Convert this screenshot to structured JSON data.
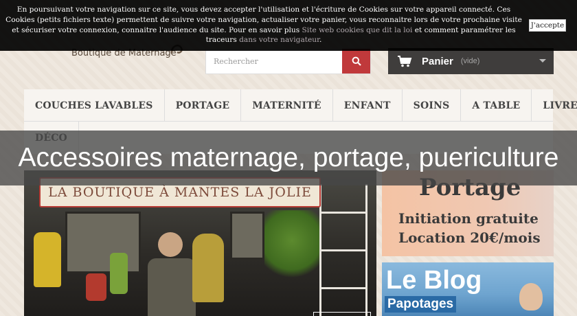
{
  "cookie_notice": {
    "text_1": "En poursuivant votre navigation sur ce site, vous devez accepter l'utilisation et l'écriture de Cookies sur votre appareil connecté. Ces Cookies (petits fichiers texte) permettent de suivre votre navigation, actualiser votre panier, vous reconnaitre lors de votre prochaine visite et sécuriser votre connexion, connaitre l'audience du site. Pour en savoir plus ",
    "link_1": "Site web cookies que dit la loi",
    "text_2": " et comment paramétrer les traceurs ",
    "link_2": "dans votre navigateur",
    "text_3": ".",
    "accept_label": "J'accepte"
  },
  "header": {
    "logo_text": "Boutique de Maternage",
    "search_placeholder": "Rechercher",
    "cart_label": "Panier",
    "cart_status": "(vide)"
  },
  "nav": {
    "row1": [
      "COUCHES LAVABLES",
      "PORTAGE",
      "MATERNITÉ",
      "ENFANT",
      "SOINS",
      "A TABLE",
      "LIVRE"
    ],
    "row2": [
      "DÉCO"
    ]
  },
  "page_title": "Accessoires maternage, portage, puericulture",
  "hero": {
    "banner": "LA BOUTIQUE À MANTES LA JOLIE"
  },
  "promo_portage": {
    "title": "Portage",
    "line1": "Initiation gratuite",
    "line2": "Location 20€/mois"
  },
  "promo_blog": {
    "title": "Le Blog",
    "subtitle": "Papotages"
  },
  "colors": {
    "accent_red": "#c0393b",
    "cart_bg": "#3f3d3c",
    "cookie_bg": "#000000"
  }
}
